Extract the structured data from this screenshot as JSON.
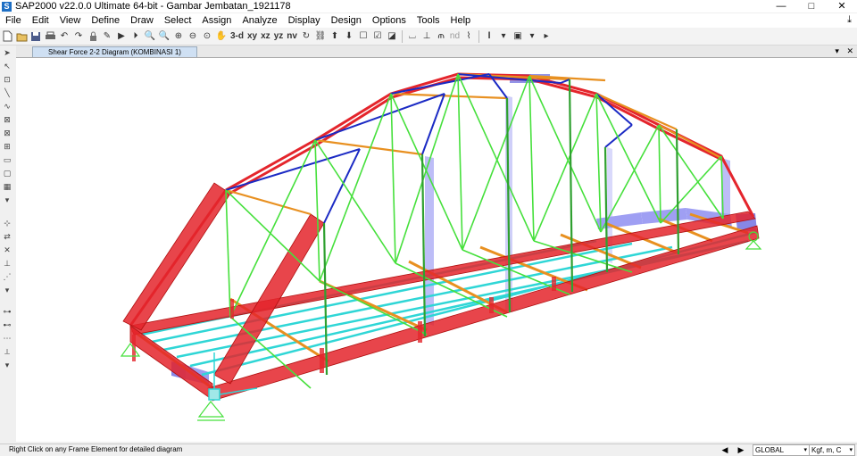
{
  "window": {
    "logo_letter": "S",
    "title": "SAP2000 v22.0.0 Ultimate 64-bit - Gambar Jembatan_1921178",
    "minimize": "—",
    "maximize": "□",
    "close": "✕"
  },
  "menu": {
    "items": [
      "File",
      "Edit",
      "View",
      "Define",
      "Draw",
      "Select",
      "Assign",
      "Analyze",
      "Display",
      "Design",
      "Options",
      "Tools",
      "Help"
    ]
  },
  "toolbar": {
    "labels": {
      "three_d": "3-d",
      "xy": "xy",
      "xz": "xz",
      "yz": "yz",
      "nv": "nv",
      "nd": "nd"
    }
  },
  "tab": {
    "title": "Shear Force 2-2 Diagram (KOMBINASI 1)",
    "dropdown": "▾",
    "close": "✕"
  },
  "status": {
    "message": "Right Click on any Frame Element for detailed diagram",
    "coord_system": "GLOBAL",
    "units": "Kgf, m, C"
  },
  "colors": {
    "chord": "#e4252c",
    "web": "#46e03c",
    "bracing": "#1b2ac4",
    "floor_beam": "#e89020",
    "deck": "#2fd6d6",
    "shear_fill": "#8080f0"
  }
}
